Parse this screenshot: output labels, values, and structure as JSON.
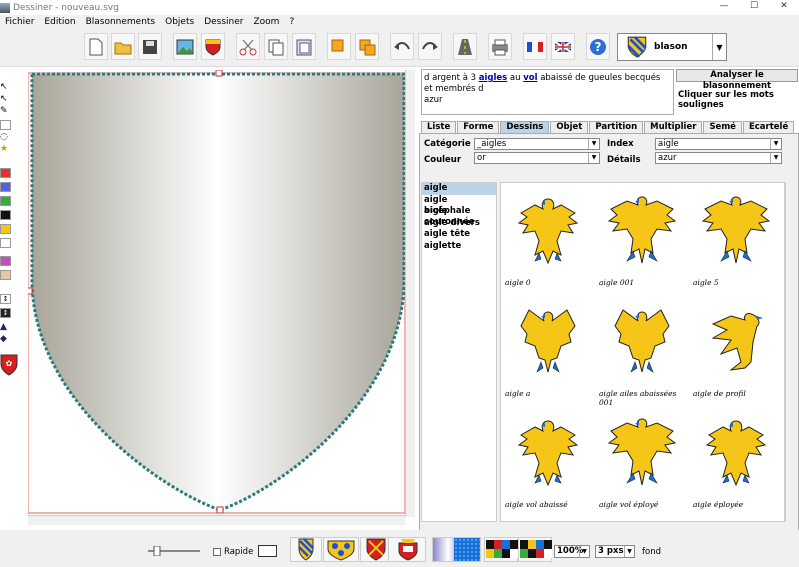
{
  "window": {
    "title": "Dessiner - nouveau.svg",
    "minimize": "—",
    "maximize": "☐",
    "close": "✕"
  },
  "menu": [
    "Fichier",
    "Edition",
    "Blasonnements",
    "Objets",
    "Dessiner",
    "Zoom",
    "?"
  ],
  "toolbar": {
    "buttons": [
      "new-icon",
      "open-folder-icon",
      "save-icon",
      "image-icon",
      "shield-icon",
      "scissors-icon",
      "copy-icon",
      "paste-icon",
      "front-icon",
      "back-icon",
      "undo-icon",
      "redo-icon",
      "road-icon",
      "print-icon",
      "flag-fr-icon",
      "flag-uk-icon",
      "help-icon"
    ],
    "blason_label": "blason"
  },
  "description": {
    "t1": "d argent à 3 ",
    "l1": "aigles",
    "t2": " au ",
    "l2": "vol",
    "t3": " abaissé de gueules becqués et membrés d",
    "t4": "azur"
  },
  "analyse_button": "Analyser le blasonnement",
  "hint": "Cliquer sur les mots soulignes",
  "tabs": [
    "Liste",
    "Forme",
    "Dessins",
    "Objet",
    "Partition",
    "Multiplier",
    "Semé",
    "Ecartelé"
  ],
  "active_tab": "Dessins",
  "fields": {
    "categorie_label": "Catégorie",
    "categorie_value": "_aigles",
    "index_label": "Index",
    "index_value": "aigle",
    "couleur_label": "Couleur",
    "couleur_value": "or",
    "details_label": "Détails",
    "details_value": "azur"
  },
  "list_items": [
    "aigle",
    "aigle bicéphale",
    "aigle couronnée",
    "aigle divers",
    "aigle tête",
    "aiglette"
  ],
  "selected_item": "aigle",
  "eagles": [
    "aigle 0",
    "aigle 001",
    "aigle 5",
    "aigle a",
    "aigle ailes abaissées 001",
    "aigle de profil",
    "aigle vol abaissé",
    "aigle vol éployé",
    "aigle éployée"
  ],
  "status": {
    "rapide_label": "Rapide",
    "zoom_value": "100%",
    "width_value": "3 pxs",
    "fond_label": "fond"
  },
  "colors": {
    "or": "#f5c518",
    "azur": "#1a6fd6",
    "gueules": "#d42020",
    "tab_active": "#bcd2e6"
  }
}
